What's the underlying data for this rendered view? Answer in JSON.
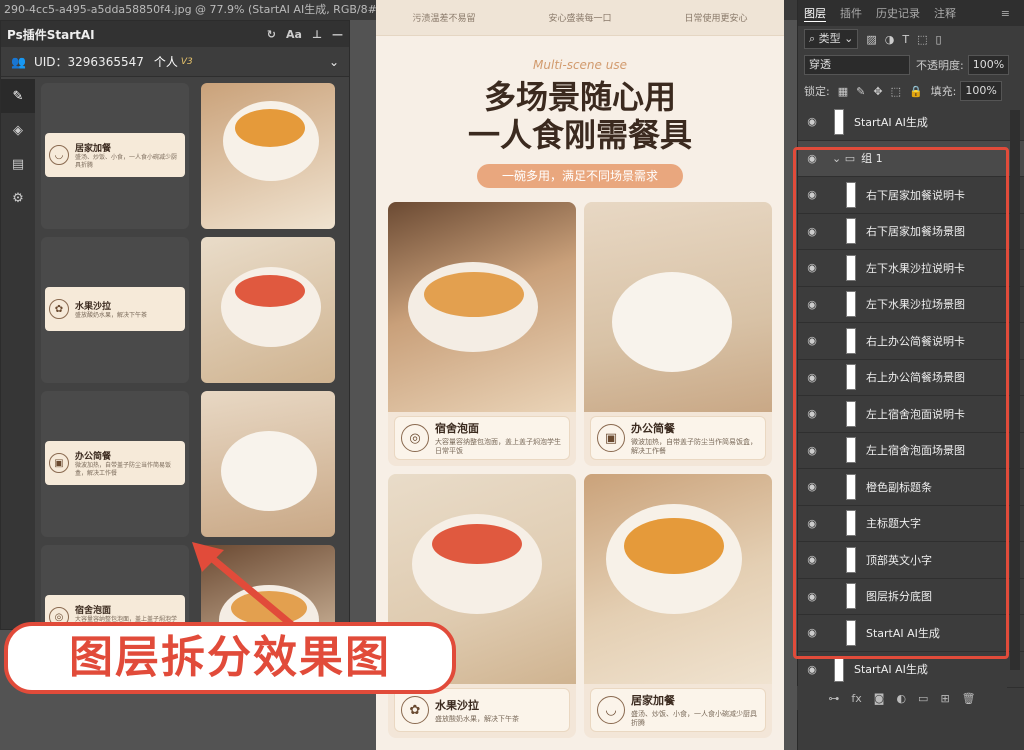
{
  "window_title": "290-4cc5-a495-a5dda58850f4.jpg @ 77.9% (StartAI AI生成, RGB/8#) *",
  "plugin": {
    "title": "Ps插件StartAI",
    "uid": "UID：3296365547",
    "plan": "个人",
    "plan_ver": "V3",
    "header_icons": [
      "refresh-icon",
      "text-icon",
      "pin-icon",
      "close-icon"
    ],
    "items": [
      {
        "title": "居家加餐",
        "desc": "盛汤、炒饭、小食，一人食小碗减少厨具折腾",
        "icon": "bowl-icon"
      },
      {
        "title": "水果沙拉",
        "desc": "盛放酸奶水果，解决下午茶",
        "icon": "fruit-icon"
      },
      {
        "title": "办公简餐",
        "desc": "微波加热，自带盖子防尘当作简易饭盒，解决工作餐",
        "icon": "briefcase-icon"
      },
      {
        "title": "宿舍泡面",
        "desc": "大容量容纳整包泡面，盖上盖子焖泡学生日常平饭",
        "icon": "noodle-icon"
      }
    ]
  },
  "caption": "图层拆分效果图",
  "doc": {
    "top_left": "污渍温差不易留",
    "top_mid": "安心盛装每一口",
    "top_right": "日常使用更安心",
    "en": "Multi-scene use",
    "title_l1": "多场景随心用",
    "title_l2": "一人食刚需餐具",
    "subtitle": "一碗多用，满足不同场景需求",
    "cards": [
      {
        "title": "宿舍泡面",
        "desc": "大容量容纳整包泡面，盖上盖子焖泡学生日常平饭",
        "icon": "noodle-icon"
      },
      {
        "title": "办公简餐",
        "desc": "微波加热，自带盖子防尘当作简易饭盒，解决工作餐",
        "icon": "briefcase-icon"
      },
      {
        "title": "水果沙拉",
        "desc": "盛放酸奶水果，解决下午茶",
        "icon": "fruit-icon"
      },
      {
        "title": "居家加餐",
        "desc": "盛汤、炒饭、小食，一人食小碗减少厨具折腾",
        "icon": "bowl-icon"
      }
    ]
  },
  "layers_panel": {
    "tabs": [
      "图层",
      "插件",
      "历史记录",
      "注释"
    ],
    "kind_label": "类型",
    "blend": "穿透",
    "opacity_label": "不透明度:",
    "opacity": "100%",
    "lock_label": "锁定:",
    "fill_label": "填充:",
    "fill": "100%",
    "layers": [
      {
        "name": "StartAI AI生成",
        "indent": false
      },
      {
        "name": "组 1",
        "indent": false
      },
      {
        "name": "右下居家加餐说明卡",
        "indent": true
      },
      {
        "name": "右下居家加餐场景图",
        "indent": true
      },
      {
        "name": "左下水果沙拉说明卡",
        "indent": true
      },
      {
        "name": "左下水果沙拉场景图",
        "indent": true
      },
      {
        "name": "右上办公简餐说明卡",
        "indent": true
      },
      {
        "name": "右上办公简餐场景图",
        "indent": true
      },
      {
        "name": "左上宿舍泡面说明卡",
        "indent": true
      },
      {
        "name": "左上宿舍泡面场景图",
        "indent": true
      },
      {
        "name": "橙色副标题条",
        "indent": true
      },
      {
        "name": "主标题大字",
        "indent": true
      },
      {
        "name": "顶部英文小字",
        "indent": true
      },
      {
        "name": "图层拆分底图",
        "indent": true
      },
      {
        "name": "StartAI AI生成",
        "indent": true
      },
      {
        "name": "StartAI AI生成",
        "indent": false
      }
    ]
  },
  "colors": {
    "accent": "#e14b3a",
    "orange": "#e9a77e",
    "cream": "#f7efe6"
  }
}
